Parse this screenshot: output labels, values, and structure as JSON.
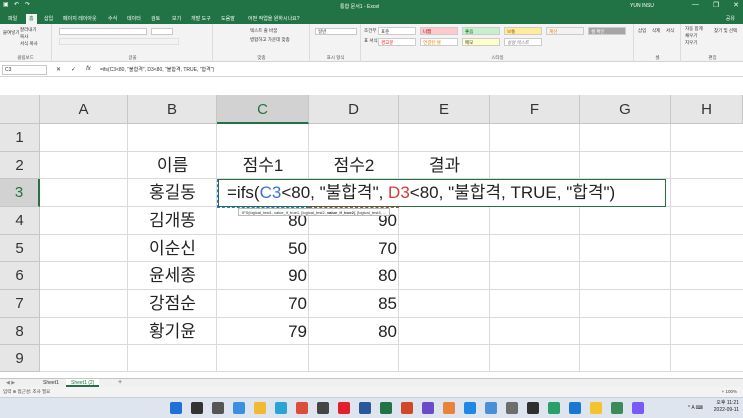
{
  "titlebar": {
    "title": "통합 문서1 - Excel",
    "user": "YUN INSU",
    "qat_icons": [
      "save-icon",
      "undo-icon",
      "redo-icon"
    ],
    "window_buttons": [
      "—",
      "❐",
      "✕"
    ]
  },
  "tabs": {
    "items": [
      "파일",
      "홈",
      "삽입",
      "페이지 레이아웃",
      "수식",
      "데이터",
      "검토",
      "보기",
      "개발 도구",
      "도움말",
      "어떤 작업을 원하시나요?"
    ],
    "active_index": 1,
    "share": "공유"
  },
  "ribbon": {
    "groups": [
      "클립보드",
      "글꼴",
      "맞춤",
      "표시 형식",
      "스타일",
      "셀",
      "편집"
    ],
    "clipboard": {
      "paste": "붙여넣기",
      "cut": "잘라내기",
      "copy": "복사",
      "format_painter": "서식 복사"
    },
    "styles": {
      "normal": "표준",
      "bad": "나쁨",
      "good": "좋음",
      "neutral": "보통",
      "calc": "계산",
      "check": "셀 확인",
      "warning": "경고문",
      "linked": "연결된 셀",
      "note": "메모",
      "explanatory": "설명 텍스트"
    },
    "cells": {
      "insert": "삽입",
      "delete": "삭제",
      "format": "서식"
    },
    "editing": {
      "autosum": "자동 합계",
      "fill": "채우기",
      "clear": "지우기",
      "sort": "정렬 및 필터",
      "find": "찾기 및 선택"
    },
    "number": {
      "format": "일반"
    },
    "align": {
      "wrap": "텍스트 줄 바꿈",
      "merge": "병합하고 가운데 맞춤"
    },
    "conditional": {
      "cf": "조건부 서식",
      "table": "표 서식"
    }
  },
  "formula_bar": {
    "name_box": "C3",
    "cancel": "✕",
    "enter": "✓",
    "fx": "fx",
    "formula": "=ifs(C3<80, \"불합격\", D3<80, \"불합격, TRUE, \"합격\")"
  },
  "grid": {
    "columns": [
      "A",
      "B",
      "C",
      "D",
      "E",
      "F",
      "G",
      "H"
    ],
    "rows": [
      "1",
      "2",
      "3",
      "4",
      "5",
      "6",
      "7",
      "8",
      "9"
    ],
    "headers": {
      "name": "이름",
      "score1": "점수1",
      "score2": "점수2",
      "result": "결과"
    },
    "records": [
      {
        "name": "홍길동",
        "score1": "",
        "score2": ""
      },
      {
        "name": "김개똥",
        "score1": "80",
        "score2": "90"
      },
      {
        "name": "이순신",
        "score1": "50",
        "score2": "70"
      },
      {
        "name": "윤세종",
        "score1": "90",
        "score2": "80"
      },
      {
        "name": "강점순",
        "score1": "70",
        "score2": "85"
      },
      {
        "name": "황기윤",
        "score1": "79",
        "score2": "80"
      }
    ],
    "edit": {
      "prefix": "=ifs(",
      "ref1": "C3",
      "mid1": "<80, \"불합격\", ",
      "ref2": "D3",
      "mid2": "<80, \"불합격, TRUE, \"합격\")"
    },
    "tooltip": {
      "p1": "IFS(logical_test1, value_if_true1, ",
      "p2": "[logical_test2, ",
      "bold": "value_if_true2",
      "p3": "], [logical_test3, ..."
    }
  },
  "sheets": {
    "tabs": [
      "Sheet1",
      "Sheet1 (2)"
    ],
    "active_index": 1,
    "add": "+"
  },
  "statusbar": {
    "left": "입력  ⊕ 접근성: 조사 필요",
    "zoom": "+ 100%"
  },
  "taskbar": {
    "icons": [
      {
        "name": "windows-start-icon",
        "color": "#1f6fd6"
      },
      {
        "name": "search-icon",
        "color": "#333333"
      },
      {
        "name": "task-view-icon",
        "color": "#555555"
      },
      {
        "name": "widgets-icon",
        "color": "#3a8fe0"
      },
      {
        "name": "file-explorer-icon",
        "color": "#f2b935"
      },
      {
        "name": "edge-icon",
        "color": "#2aa3d6"
      },
      {
        "name": "chrome-icon",
        "color": "#dd4b39"
      },
      {
        "name": "store-icon",
        "color": "#444444"
      },
      {
        "name": "opera-icon",
        "color": "#e0202c"
      },
      {
        "name": "word-icon",
        "color": "#2b579a"
      },
      {
        "name": "excel-icon",
        "color": "#217346"
      },
      {
        "name": "powerpoint-icon",
        "color": "#d24726"
      },
      {
        "name": "media-icon",
        "color": "#6b4cc8"
      },
      {
        "name": "paint-icon",
        "color": "#e8833a"
      },
      {
        "name": "vscode-icon",
        "color": "#1e88e5"
      },
      {
        "name": "photos-icon",
        "color": "#4a90d9"
      },
      {
        "name": "settings-icon",
        "color": "#6d6d6d"
      },
      {
        "name": "terminal-icon",
        "color": "#2f2f2f"
      },
      {
        "name": "app-icon",
        "color": "#27a06a"
      },
      {
        "name": "mail-icon",
        "color": "#1976d2"
      },
      {
        "name": "notes-icon",
        "color": "#f4c430"
      },
      {
        "name": "app2-icon",
        "color": "#3d8b5a"
      },
      {
        "name": "app3-icon",
        "color": "#7a5af5"
      }
    ],
    "time": "오후 11:21",
    "date": "2022-09-11",
    "tray": "^  A  ⌨"
  },
  "colors": {
    "accent": "#217346",
    "ref_blue": "#3a6fd8",
    "ref_red": "#d43b3b"
  }
}
